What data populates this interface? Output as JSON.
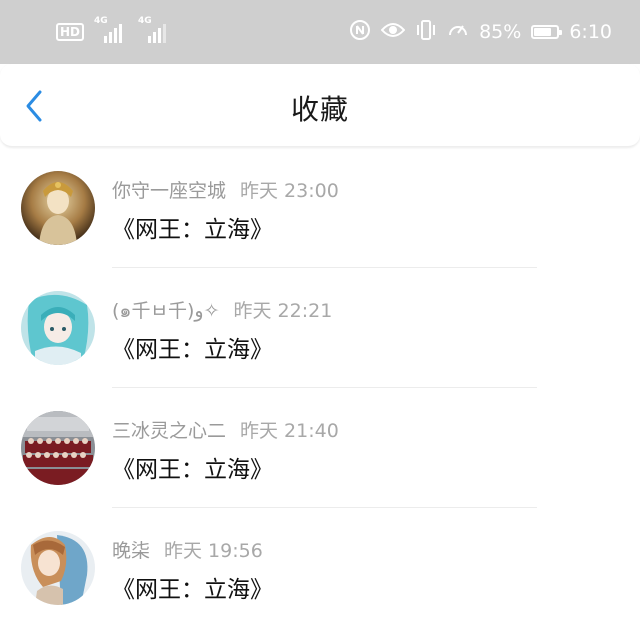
{
  "status_bar": {
    "hd": "HD",
    "sim1": "4G",
    "sim2": "4G",
    "battery_percent": "85%",
    "battery_level": 0.85,
    "time": "6:10",
    "icons": [
      "hd-icon",
      "signal-icon",
      "signal-icon",
      "nfc-icon",
      "eye-icon",
      "vibrate-icon",
      "speed-icon",
      "battery-icon"
    ]
  },
  "nav": {
    "back_icon": "chevron-left-icon",
    "title": "收藏",
    "accent": "#2b8ce3"
  },
  "favorites": [
    {
      "author": "你守一座空城",
      "time": "昨天 23:00",
      "title": "《网王：立海》",
      "avatar": "avatar-1"
    },
    {
      "author": "(๑千ㅂ千)و✧",
      "time": "昨天 22:21",
      "title": "《网王：立海》",
      "avatar": "avatar-2"
    },
    {
      "author": "三冰灵之心二",
      "time": "昨天 21:40",
      "title": "《网王：立海》",
      "avatar": "avatar-3"
    },
    {
      "author": "晚柒",
      "time": "昨天 19:56",
      "title": "《网王：立海》",
      "avatar": "avatar-4"
    }
  ]
}
